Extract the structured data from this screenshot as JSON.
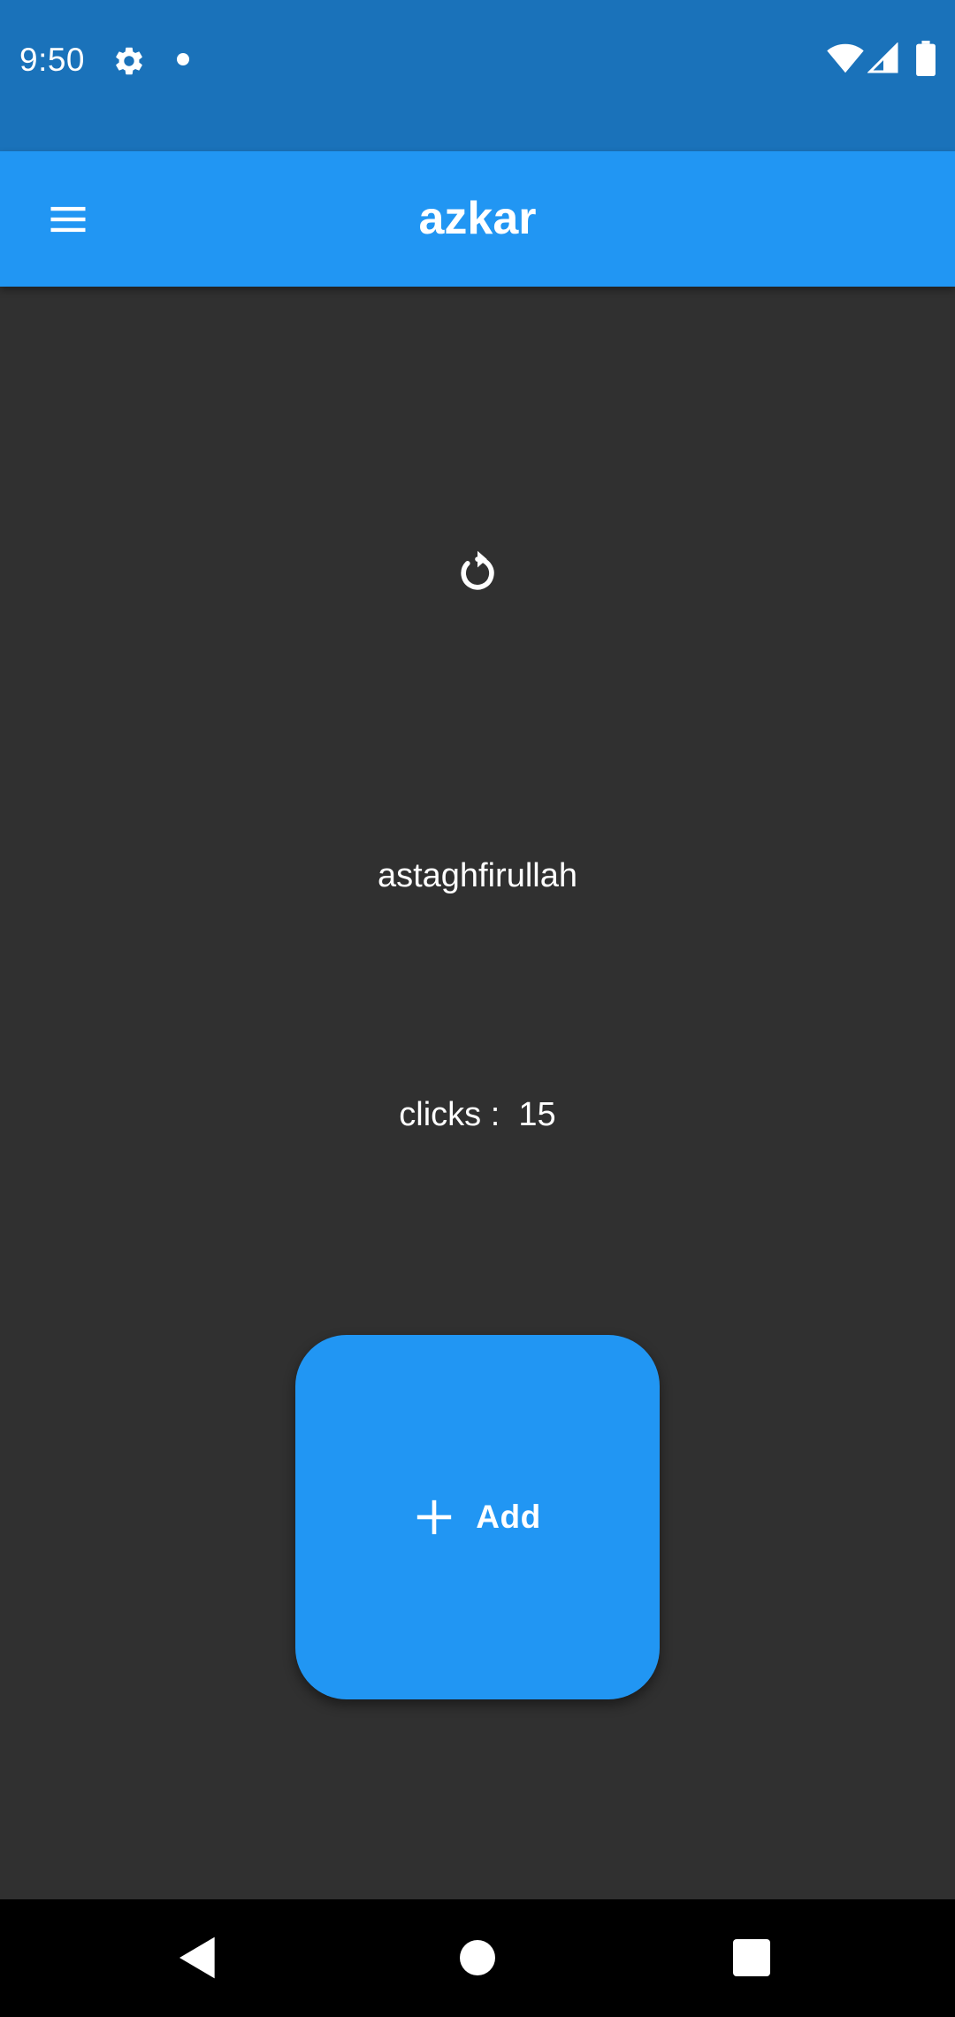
{
  "status_bar": {
    "time": "9:50",
    "icons": [
      "settings-gear-icon",
      "notification-dot-icon",
      "wifi-icon",
      "cell-signal-icon",
      "battery-icon"
    ],
    "background_color": "#1a72ba"
  },
  "app_bar": {
    "title": "azkar",
    "menu_icon": "hamburger-menu-icon",
    "background_color": "#2196f3"
  },
  "main": {
    "reset_icon": "refresh-reset-icon",
    "zikr": "astaghfirullah",
    "clicks_label": "clicks :",
    "clicks_value": "15",
    "add_button": {
      "icon": "plus-icon",
      "label": "Add",
      "color": "#2196f3"
    },
    "background_color": "#303030"
  },
  "nav_bar": {
    "buttons": [
      "back-icon",
      "home-icon",
      "recents-icon"
    ],
    "background_color": "#000000"
  }
}
